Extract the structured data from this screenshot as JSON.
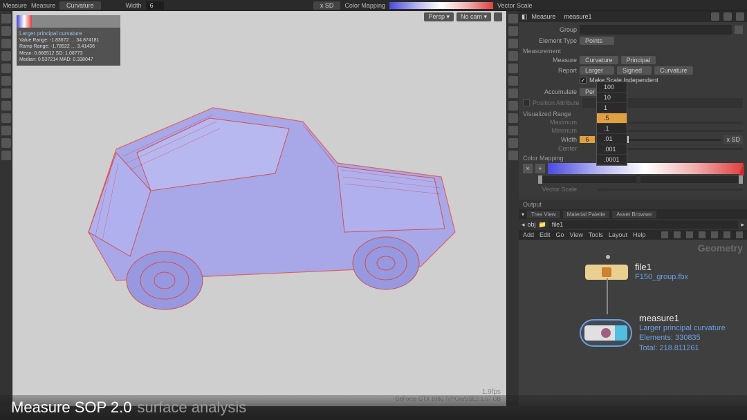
{
  "topbar": {
    "app_label": "Measure",
    "tab_label": "Measure",
    "dropdown1": "Curvature",
    "width_label": "Width",
    "width_value": "6",
    "xsd_label": "x SD",
    "colormap_label": "Color Mapping",
    "vecscale_label": "Vector Scale"
  },
  "infobox": {
    "title": "Larger principal curvature",
    "value_range": "Value Range: -1.83672 … 34.874181",
    "ramp_range": "Ramp Range: -1.78522 … 3.41436",
    "mean": "Mean: 0.666512 SD: 1.08773",
    "median": "Median: 0.537214 MAD: 0.338047"
  },
  "viewport": {
    "persp": "Persp ▾",
    "nocam": "No cam ▾",
    "fps": "1.9fps",
    "gpu": "GeForce GTX 1080 Ti/PCIe/SSE2  1.57 GB"
  },
  "rp": {
    "header_icon": "Measure",
    "node_name": "measure1",
    "group_label": "Group",
    "eltype_label": "Element Type",
    "eltype_value": "Points",
    "measurement_label": "Measurement",
    "measure_label": "Measure",
    "measure_val": "Curvature",
    "measure_val2": "Principal",
    "report_label": "Report",
    "report_val1": "Larger",
    "report_val2": "Signed",
    "report_val3": "Curvature",
    "scaleind_label": "Make Scale Independent",
    "accumulate_label": "Accumulate",
    "accumulate_val": "Per Element",
    "posattr_label": "Position Attribute",
    "visrange_label": "Visualized Range",
    "maximum_label": "Maximum",
    "minimum_label": "Minimum",
    "width_label": "Width",
    "width_val": "6",
    "width_unit": "x SD",
    "center_label": "Center",
    "colormap_label": "Color Mapping",
    "vecscale_label": "Vector Scale",
    "output_label": "Output",
    "dropdown_opts": [
      "100",
      "10",
      "1",
      ".5",
      ".1",
      ".01",
      ".001",
      ".0001"
    ],
    "dropdown_sel": ".5"
  },
  "tabs": {
    "t1": "Tree View",
    "t2": "Material Palette",
    "t3": "Asset Browser"
  },
  "path": {
    "seg1": "obj",
    "seg2": "file1"
  },
  "menu": {
    "m1": "Add",
    "m2": "Edit",
    "m3": "Go",
    "m4": "View",
    "m5": "Tools",
    "m6": "Layout",
    "m7": "Help"
  },
  "net": {
    "geo": "Geometry",
    "n1_label": "file1",
    "n1_sub": "F150_group.fbx",
    "n2_label": "measure1",
    "n2_sub1": "Larger principal  curvature",
    "n2_sub2": "Elements: 330835",
    "n2_sub3": "Total: 218.811261"
  },
  "caption": {
    "c1": "Measure SOP 2.0",
    "c2": "surface analysis"
  }
}
